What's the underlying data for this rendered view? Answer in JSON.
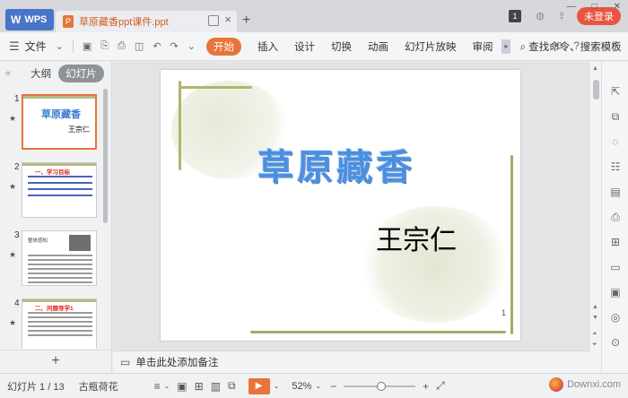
{
  "titlebar": {
    "app_label": "WPS",
    "doc_tab_name": "草原藏香ppt课件.ppt",
    "new_tab": "+",
    "badge": "1",
    "login_label": "未登录"
  },
  "menubar": {
    "file_label": "文件",
    "start_label": "开始",
    "items": [
      "插入",
      "设计",
      "切换",
      "动画",
      "幻灯片放映",
      "审阅"
    ],
    "search_label": "查找命令、搜索模板"
  },
  "leftpanel": {
    "outline_label": "大纲",
    "slides_label": "幻灯片",
    "thumbs": [
      {
        "num": "1",
        "title": "草原藏香",
        "author": "王宗仁"
      },
      {
        "num": "2",
        "title": "一、学习目标"
      },
      {
        "num": "3",
        "title": "整体感知"
      },
      {
        "num": "4",
        "title": "二、问题导学1"
      }
    ],
    "add_label": "+"
  },
  "slide": {
    "title": "草原藏香",
    "author": "王宗仁",
    "page_number": "1"
  },
  "notes": {
    "placeholder": "单击此处添加备注"
  },
  "statusbar": {
    "slide_counter": "幻灯片 1 / 13",
    "theme_name": "古瓶荷花",
    "zoom": "52%",
    "zoom_fraction": 0.52
  },
  "watermark": {
    "text": "Downxi.com"
  },
  "colors": {
    "accent": "#e8743a",
    "wps_blue": "#4a74c9",
    "login_red": "#e8543f",
    "title_blue": "#4a8fe0"
  }
}
